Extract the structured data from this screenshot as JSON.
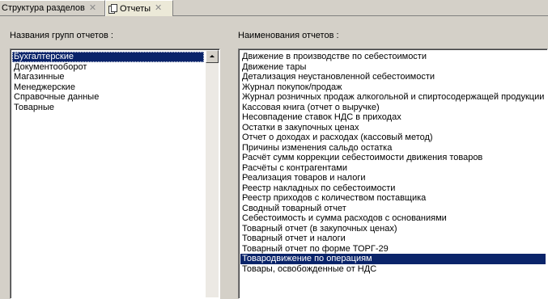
{
  "tabs": [
    {
      "label": "Структура разделов",
      "close": "✕"
    },
    {
      "label": "Отчеты",
      "close": "✕"
    }
  ],
  "report_groups": {
    "label": "Названия групп отчетов :",
    "items": [
      "Бухгалтерские",
      "Документооборот",
      "Магазинные",
      "Менеджерские",
      "Справочные данные",
      "Товарные"
    ],
    "selected_index": 0
  },
  "report_names": {
    "label": "Наименования отчетов :",
    "items": [
      "Движение в производстве по себестоимости",
      "Движение тары",
      "Детализация неустановленной себестоимости",
      "Журнал покупок/продаж",
      "Журнал розничных продаж алкогольной и спиртосодержащей продукции",
      "Кассовая книга (отчет о выручке)",
      "Несовпадение ставок НДС в приходах",
      "Остатки в закупочных ценах",
      "Отчет о доходах и расходах (кассовый метод)",
      "Причины изменения сальдо остатка",
      "Расчёт сумм коррекции себестоимости движения товаров",
      "Расчёты с контрагентами",
      "Реализация товаров и налоги",
      "Реестр накладных по себестоимости",
      "Реестр приходов с количеством поставщика",
      "Сводный товарный отчет",
      "Себестоимость и сумма расходов с основаниями",
      "Товарный отчет (в закупочных ценах)",
      "Товарный отчет и налоги",
      "Товарный отчет по форме ТОРГ-29",
      "Товародвижение по операциям",
      "Товары, освобожденные от НДС"
    ],
    "selected_index": 20
  },
  "colors": {
    "selection": "#0a246a",
    "window_bg": "#d4d0c8"
  },
  "icons": {
    "active_tab": "pages-icon",
    "scroll_up": "arrow-up-icon"
  }
}
